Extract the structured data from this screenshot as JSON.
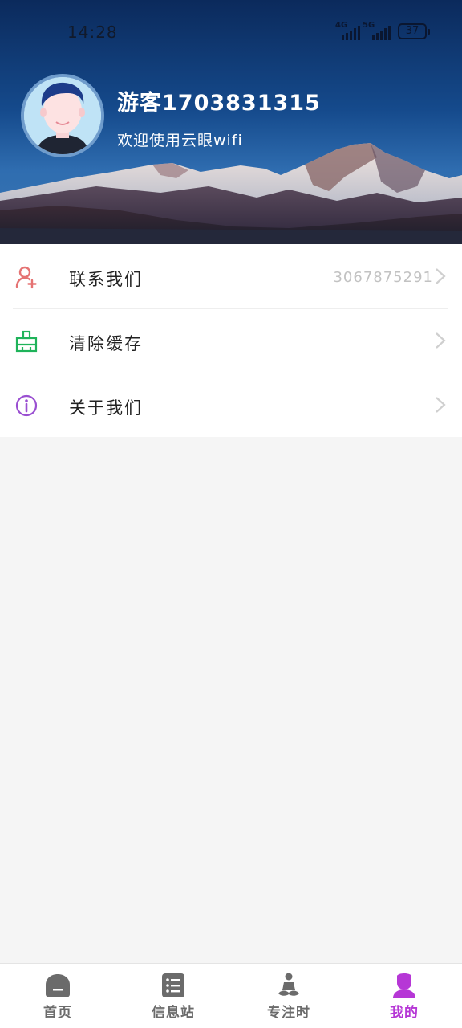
{
  "status_bar": {
    "time": "14:28",
    "signal_1_label": "4G",
    "signal_2_label": "5G",
    "battery": "37"
  },
  "profile": {
    "username": "游客1703831315",
    "welcome": "欢迎使用云眼wifi"
  },
  "menu": {
    "items": [
      {
        "label": "联系我们",
        "value": "3067875291",
        "icon": "add-person-icon",
        "color": "#e57373"
      },
      {
        "label": "清除缓存",
        "value": "",
        "icon": "broom-icon",
        "color": "#1fb35a"
      },
      {
        "label": "关于我们",
        "value": "",
        "icon": "info-icon",
        "color": "#9a4fd1"
      }
    ]
  },
  "bottom_nav": {
    "items": [
      {
        "label": "首页",
        "icon": "home-icon"
      },
      {
        "label": "信息站",
        "icon": "list-icon"
      },
      {
        "label": "专注时",
        "icon": "meditation-icon"
      },
      {
        "label": "我的",
        "icon": "profile-icon",
        "active": true
      }
    ],
    "active_color": "#b637d6",
    "inactive_color": "#6b6b6b"
  }
}
